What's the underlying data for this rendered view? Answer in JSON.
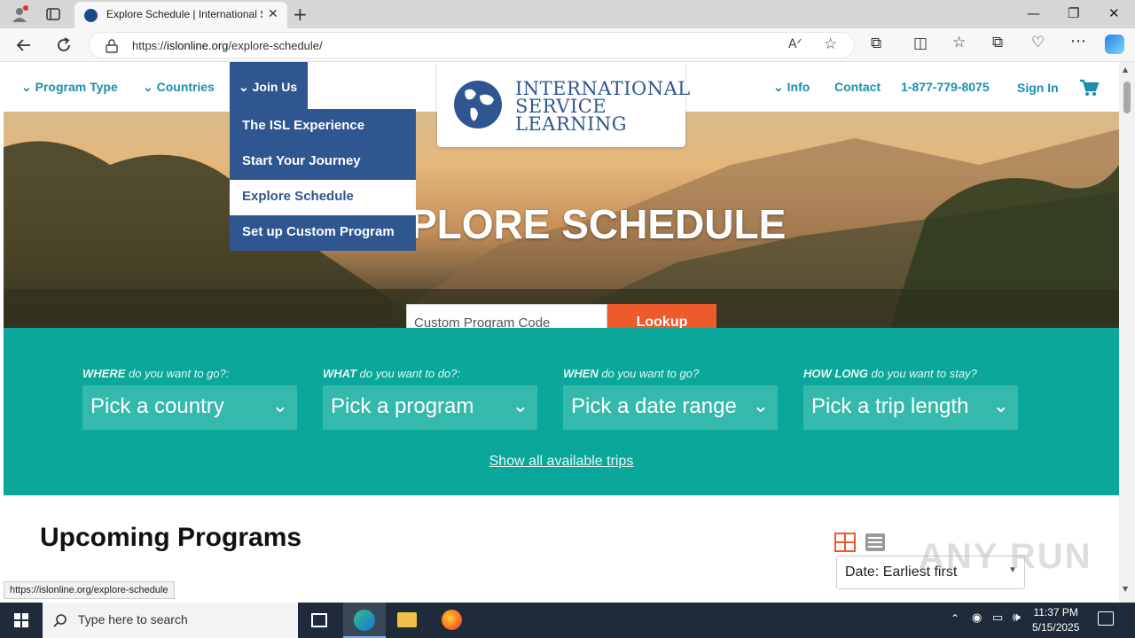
{
  "browser": {
    "tab_title": "Explore Schedule | International S",
    "url_prefix": "https://",
    "url_host": "islonline.org",
    "url_path": "/explore-schedule/",
    "status_url": "https://islonline.org/explore-schedule"
  },
  "nav": {
    "program_type": "Program Type",
    "countries": "Countries",
    "join_us": "Join Us",
    "info": "Info",
    "contact": "Contact",
    "phone": "1-877-779-8075",
    "sign_in": "Sign In"
  },
  "logo": {
    "line1": "INTERNATIONAL",
    "line2": "SERVICE",
    "line3": "LEARNING"
  },
  "dropdown": {
    "items": [
      {
        "label": "The ISL Experience",
        "active": false
      },
      {
        "label": "Start Your Journey",
        "active": false
      },
      {
        "label": "Explore Schedule",
        "active": true
      },
      {
        "label": "Set up Custom Program",
        "active": false
      }
    ]
  },
  "hero": {
    "title": "PLORE SCHEDULE",
    "code_placeholder": "Custom Program Code",
    "lookup_label": "Lookup"
  },
  "filters": {
    "where_bold": "WHERE",
    "where_rest": " do you want to go?:",
    "where_value": "Pick a country",
    "what_bold": "WHAT",
    "what_rest": " do you want to do?:",
    "what_value": "Pick a program",
    "when_bold": "WHEN",
    "when_rest": " do you want to go?",
    "when_value": "Pick a date range",
    "howlong_bold": "HOW LONG",
    "howlong_rest": " do you want to stay?",
    "howlong_value": "Pick a trip length",
    "show_all": "Show all available trips"
  },
  "upcoming": {
    "title": "Upcoming Programs",
    "sort_value": "Date: Earliest first"
  },
  "watermark": "ANY RUN",
  "taskbar": {
    "search_placeholder": "Type here to search",
    "time": "11:37 PM",
    "date": "5/15/2025"
  },
  "colors": {
    "brand_blue": "#2f5690",
    "teal": "#0aa79a",
    "orange": "#ef5a2c",
    "link_blue": "#1a8fb0"
  }
}
